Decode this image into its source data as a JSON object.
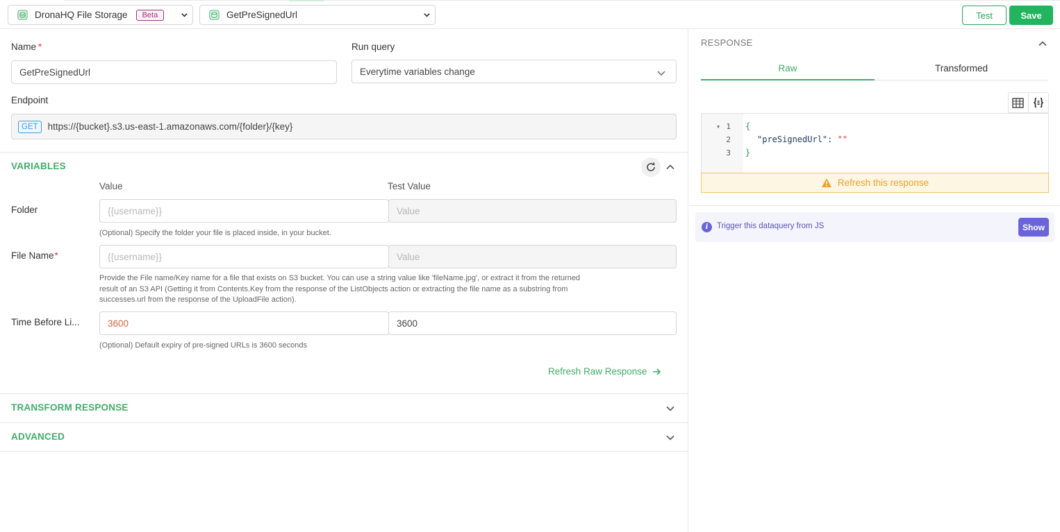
{
  "topbar": {
    "datasource": {
      "label": "DronaHQ File Storage",
      "badge": "Beta"
    },
    "action": {
      "label": "GetPreSignedUrl"
    },
    "test_label": "Test",
    "save_label": "Save"
  },
  "form": {
    "name_label": "Name",
    "name_required": "*",
    "name_value": "GetPreSignedUrl",
    "run_query_label": "Run query",
    "run_query_value": "Everytime variables change",
    "endpoint_label": "Endpoint",
    "endpoint_method": "GET",
    "endpoint_url": "https://{bucket}.s3.us-east-1.amazonaws.com/{folder}/{key}"
  },
  "variables": {
    "title": "VARIABLES",
    "value_header": "Value",
    "test_value_header": "Test Value",
    "rows": [
      {
        "label": "Folder",
        "required": "",
        "value": "{{username}}",
        "test_value": "Value",
        "hint": "(Optional) Specify the folder your file is placed inside, in your bucket."
      },
      {
        "label": "File Name",
        "required": "*",
        "value": "{{username}}",
        "test_value": "Value",
        "hint_lines": [
          "Provide the File name/Key name for a file that exists on S3 bucket. You can use a string value like 'fileName.jpg', or extract it from the returned",
          "result of an S3 API (Getting it from Contents.Key from the response of the ListObjects action or extracting the file name as a substring from",
          "successes.url from the response of the UploadFile action)."
        ]
      },
      {
        "label": "Time Before Li...",
        "required": "",
        "value": "3600",
        "test_value": "3600",
        "hint": "(Optional) Default expiry of pre-signed URLs is 3600 seconds"
      }
    ],
    "refresh_raw_label": "Refresh Raw Response"
  },
  "sections": {
    "transform": "TRANSFORM RESPONSE",
    "advanced": "ADVANCED"
  },
  "response": {
    "title": "RESPONSE",
    "tabs": [
      "Raw",
      "Transformed"
    ],
    "active_tab": "Raw",
    "code": {
      "line_numbers": [
        "1",
        "2",
        "3"
      ],
      "open_brace": "{",
      "key": "\"preSignedUrl\"",
      "colon": ": ",
      "value": "\"\"",
      "close_brace": "}"
    },
    "refresh_label": "Refresh this response",
    "trigger_text": "Trigger this dataquery from JS",
    "show_label": "Show"
  },
  "colors": {
    "accent_green": "#22b45f",
    "section_green": "#3fae6a",
    "purple": "#6b64d9",
    "warning": "#f0a030"
  }
}
